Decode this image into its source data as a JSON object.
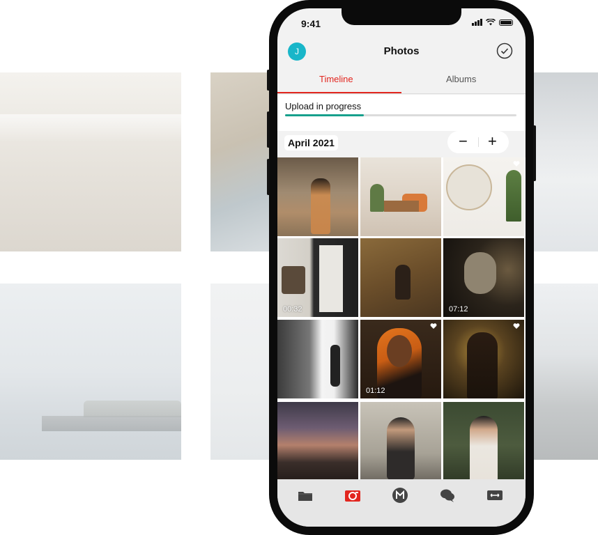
{
  "status_bar": {
    "time": "9:41"
  },
  "header": {
    "avatar_initial": "J",
    "title": "Photos"
  },
  "tabs": [
    {
      "label": "Timeline"
    },
    {
      "label": "Albums"
    }
  ],
  "upload": {
    "label": "Upload in progress",
    "progress": 0.34
  },
  "section": {
    "date": "April 2021"
  },
  "zoom_controls": {
    "minus": "−",
    "plus": "+"
  },
  "photos": [
    {
      "id": 1
    },
    {
      "id": 2
    },
    {
      "id": 3,
      "favorite": true
    },
    {
      "id": 4,
      "duration": "00:32"
    },
    {
      "id": 5
    },
    {
      "id": 6,
      "duration": "07:12"
    },
    {
      "id": 7
    },
    {
      "id": 8,
      "duration": "01:12",
      "favorite": true
    },
    {
      "id": 9,
      "favorite": true
    },
    {
      "id": 10
    },
    {
      "id": 11
    },
    {
      "id": 12
    }
  ],
  "bottom_nav": [
    {
      "icon": "folder-icon"
    },
    {
      "icon": "camera-icon",
      "active": true
    },
    {
      "icon": "mega-icon"
    },
    {
      "icon": "chat-icon"
    },
    {
      "icon": "transfer-icon"
    }
  ],
  "colors": {
    "accent": "#e2261f",
    "progress": "#17a08c",
    "avatar": "#19b6c9",
    "screen_bg": "#f2f2f2"
  }
}
